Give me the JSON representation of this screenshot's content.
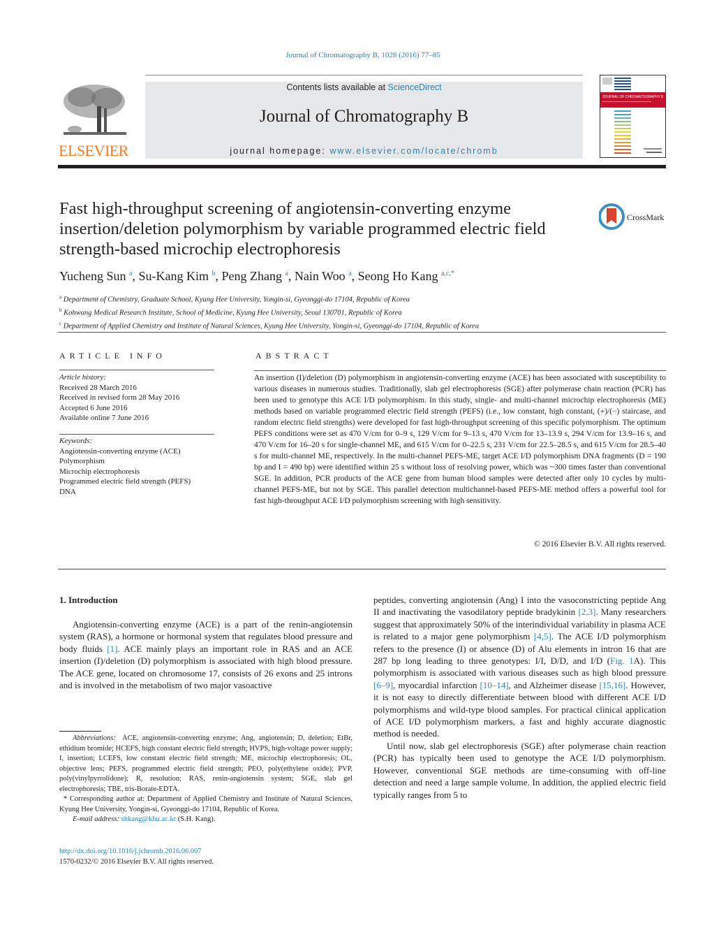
{
  "header": {
    "citation": "Journal of Chromatography B, 1028 (2016) 77–85",
    "contents_prefix": "Contents lists available at ",
    "contents_link": "ScienceDirect",
    "journal_name": "Journal of Chromatography B",
    "homepage_prefix": "journal homepage: ",
    "homepage_link": "www.elsevier.com/locate/chromb",
    "publisher_logo_text": "ELSEVIER",
    "cover_title": "JOURNAL OF CHROMATOGRAPHY B",
    "brand_colors": {
      "link": "#2a86b0",
      "elsevier_orange": "#f47a20",
      "cover_red": "#c8102e"
    }
  },
  "article": {
    "title": "Fast high-throughput screening of angiotensin-converting enzyme insertion/deletion polymorphism by variable programmed electric field strength-based microchip electrophoresis",
    "crossmark_label": "CrossMark",
    "authors": [
      {
        "name": "Yucheng Sun",
        "sup": "a"
      },
      {
        "name": "Su-Kang Kim",
        "sup": "b"
      },
      {
        "name": "Peng Zhang",
        "sup": "a"
      },
      {
        "name": "Nain Woo",
        "sup": "a"
      },
      {
        "name": "Seong Ho Kang",
        "sup": "a,c,*"
      }
    ],
    "affiliations": [
      {
        "mark": "a",
        "text": "Department of Chemistry, Graduate School, Kyung Hee University, Yongin-si, Gyeonggi-do 17104, Republic of Korea"
      },
      {
        "mark": "b",
        "text": "Kohwang Medical Research Institute, School of Medicine, Kyung Hee University, Seoul 130701, Republic of Korea"
      },
      {
        "mark": "c",
        "text": "Department of Applied Chemistry and Institute of Natural Sciences, Kyung Hee University, Yongin-si, Gyeonggi-do 17104, Republic of Korea"
      }
    ]
  },
  "article_info": {
    "label": "ARTICLE INFO",
    "history_label": "Article history:",
    "history": [
      "Received 28 March 2016",
      "Received in revised form 28 May 2016",
      "Accepted 6 June 2016",
      "Available online 7 June 2016"
    ],
    "keywords_label": "Keywords:",
    "keywords": [
      "Angiotensin-converting enzyme (ACE)",
      "Polymorphism",
      "Microchip electrophoresis",
      "Programmed electric field strength (PEFS)",
      "DNA"
    ]
  },
  "abstract": {
    "label": "ABSTRACT",
    "text": "An insertion (I)/deletion (D) polymorphism in angiotensin-converting enzyme (ACE) has been associated with susceptibility to various diseases in numerous studies. Traditionally, slab gel electrophoresis (SGE) after polymerase chain reaction (PCR) has been used to genotype this ACE I/D polymorphism. In this study, single- and multi-channel microchip electrophoresis (ME) methods based on variable programmed electric field strength (PEFS) (i.e., low constant, high constant, (+)/(−) staircase, and random electric field strengths) were developed for fast high-throughput screening of this specific polymorphism. The optimum PEFS conditions were set as 470 V/cm for 0–9 s, 129 V/cm for 9–13 s, 470 V/cm for 13–13.9 s, 294 V/cm for 13.9–16 s, and 470 V/cm for 16–20 s for single-channel ME, and 615 V/cm for 0–22.5 s, 231 V/cm for 22.5–28.5 s, and 615 V/cm for 28.5–40 s for multi-channel ME, respectively. In the multi-channel PEFS-ME, target ACE I/D polymorphism DNA fragments (D = 190 bp and I = 490 bp) were identified within 25 s without loss of resolving power, which was ~300 times faster than conventional SGE. In addition, PCR products of the ACE gene from human blood samples were detected after only 10 cycles by multi-channel PEFS-ME, but not by SGE. This parallel detection multichannel-based PEFS-ME method offers a powerful tool for fast high-throughput ACE I/D polymorphism screening with high sensitivity.",
    "copyright": "© 2016 Elsevier B.V. All rights reserved."
  },
  "body": {
    "section_heading": "1.  Introduction",
    "left_para": [
      {
        "t": "Angiotensin-converting enzyme (ACE) is a part of the renin-angiotensin system (RAS), a hormone or hormonal system that regulates blood pressure and body fluids "
      },
      {
        "ref": "[1]"
      },
      {
        "t": ". ACE mainly plays an important role in RAS and an ACE insertion (I)/deletion (D) polymorphism is associated with high blood pressure. The ACE gene, located on chromosome 17, consists of 26 exons and 25 introns and is involved in the metabolism of two major vasoactive"
      }
    ],
    "right_para1": [
      {
        "t": "peptides, converting angiotensin (Ang) I into the vasoconstricting peptide Ang II and inactivating the vasodilatory peptide bradykinin "
      },
      {
        "ref": "[2,3]"
      },
      {
        "t": ". Many researchers suggest that approximately 50% of the interindividual variability in plasma ACE is related to a major gene polymorphism "
      },
      {
        "ref": "[4,5]"
      },
      {
        "t": ". The ACE I/D polymorphism refers to the presence (I) or absence (D) of Alu elements in intron 16 that are 287 bp long leading to three genotypes: I/I, D/D, and I/D ("
      },
      {
        "ref": "Fig. 1"
      },
      {
        "t": "A). This polymorphism is associated with various diseases such as high blood pressure "
      },
      {
        "ref": "[6–9]"
      },
      {
        "t": ", myocardial infarction "
      },
      {
        "ref": "[10–14]"
      },
      {
        "t": ", and Alzheimer disease "
      },
      {
        "ref": "[15,16]"
      },
      {
        "t": ". However, it is not easy to directly differentiate between blood with different ACE I/D polymorphisms and wild-type blood samples. For practical clinical application of ACE I/D polymorphism markers, a fast and highly accurate diagnostic method is needed."
      }
    ],
    "right_para2": "Until now, slab gel electrophoresis (SGE) after polymerase chain reaction (PCR) has typically been used to genotype the ACE I/D polymorphism. However, conventional SGE methods are time-consuming with off-line detection and need a large sample volume. In addition, the applied electric field typically ranges from 5 to"
  },
  "footnotes": {
    "abbrev_label": "Abbreviations:",
    "abbrev_text": "ACE, angiotensin-converting enzyme; Ang, angiotensin; D, deletion; EtBr, ethidium bromide; HCEFS, high constant electric field strength; HVPS, high-voltage power supply; I, insertion; LCEFS, low constant electric field strength; ME, microchip electrophoresis; OL, objective lens; PEFS, programmed electric field strength; PEO, poly(ethylene oxide); PVP, poly(vinylpyrrolidone); R, resolution; RAS, renin-angiotensin system; SGE, slab gel electrophoresis; TBE, tris-Borate-EDTA.",
    "corresponding": "* Corresponding author at: Department of Applied Chemistry and Institute of Natural Sciences, Kyung Hee University, Yongin-si, Gyeonggi-do 17104, Republic of Korea.",
    "email_label": "E-mail address:",
    "email": "shkang@khu.ac.kr",
    "email_suffix": " (S.H. Kang).",
    "doi": "http://dx.doi.org/10.1016/j.jchromb.2016.06.007",
    "issn": "1570-0232/© 2016 Elsevier B.V. All rights reserved."
  }
}
